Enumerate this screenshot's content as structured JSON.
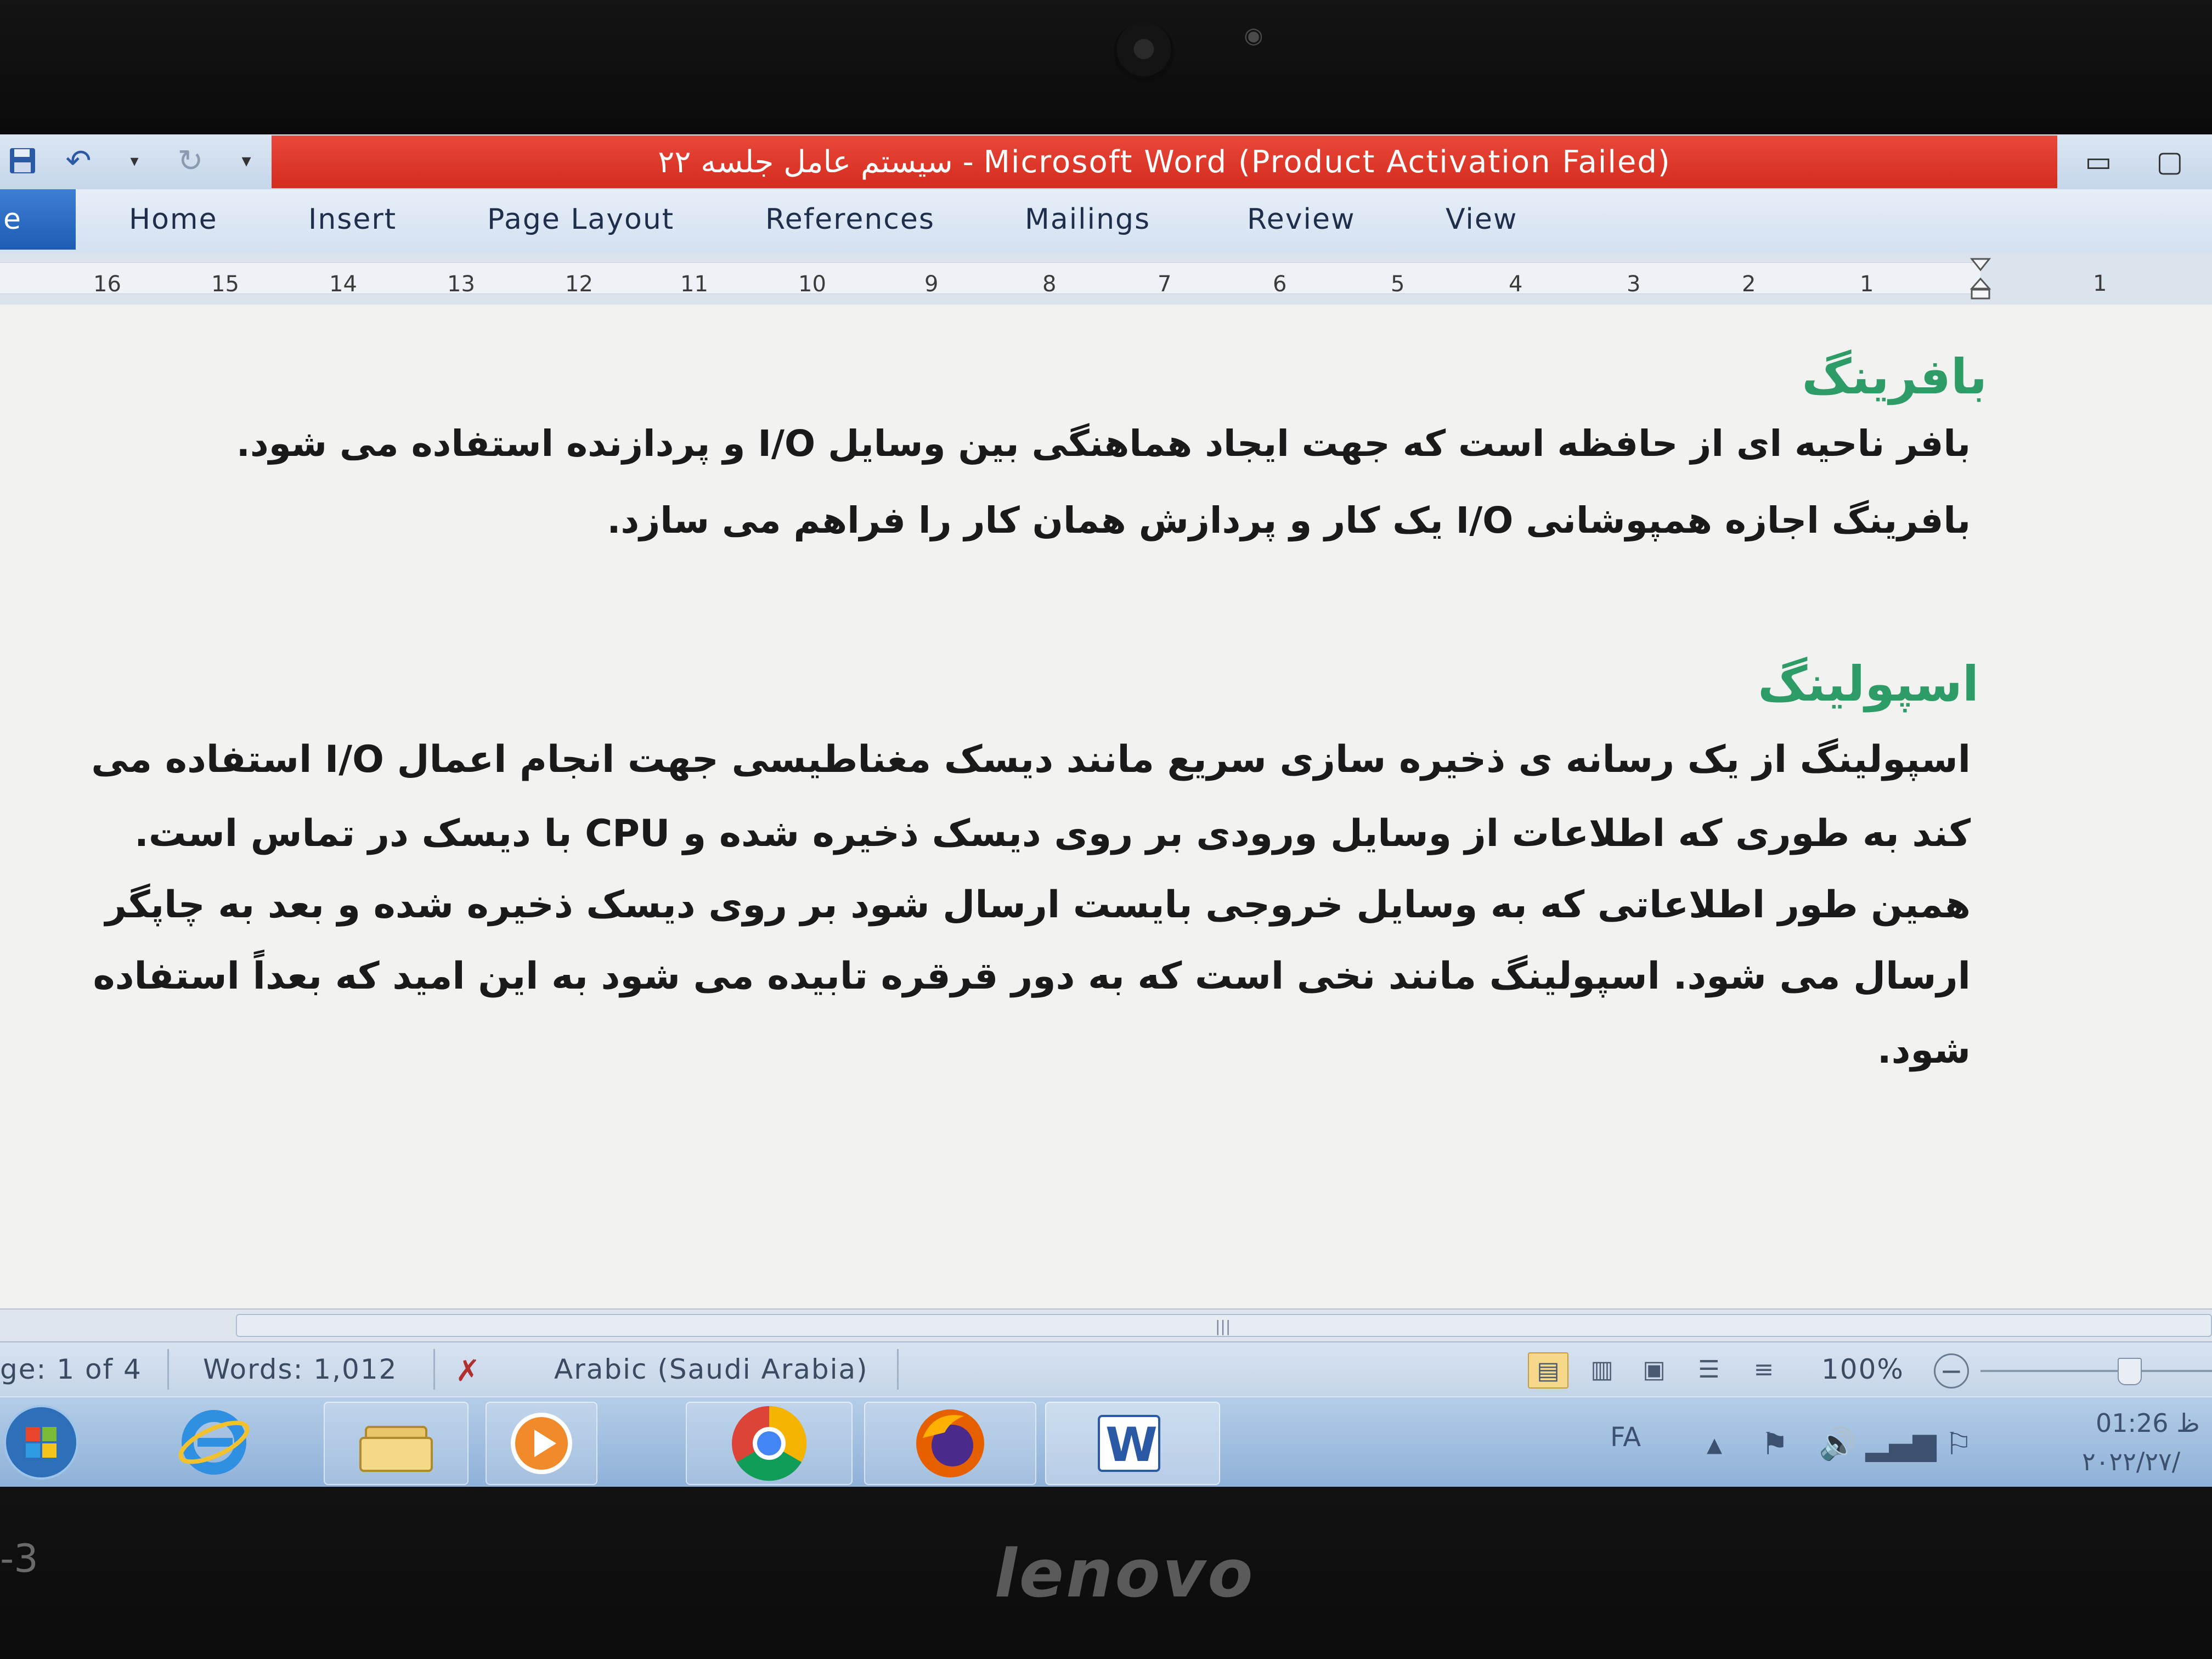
{
  "window": {
    "title": "سیستم عامل جلسه ۲۲  -  Microsoft Word (Product Activation Failed)",
    "title_bar_color": "#d9352a",
    "qat_icons": [
      "save-icon",
      "undo-icon",
      "redo-icon",
      "customize-icon"
    ],
    "controls": [
      "minimize-icon",
      "restore-icon"
    ]
  },
  "ribbon": {
    "file_tab": "e",
    "tabs": [
      "Home",
      "Insert",
      "Page Layout",
      "References",
      "Mailings",
      "Review",
      "View"
    ]
  },
  "ruler": {
    "numbers": [
      "16",
      "15",
      "14",
      "13",
      "12",
      "11",
      "10",
      "9",
      "8",
      "7",
      "6",
      "5",
      "4",
      "3",
      "2",
      "1",
      "1"
    ]
  },
  "document": {
    "heading1": "بافرینگ",
    "para1": [
      "بافر ناحیه ای از حافظه است که جهت ایجاد هماهنگی بین وسایل I/O و پردازنده استفاده می شود.",
      "بافرینگ اجازه همپوشانی I/O یک کار و پردازش همان کار را فراهم می سازد."
    ],
    "heading2": "اسپولینگ",
    "para2": [
      "اسپولینگ از یک رسانه ی ذخیره سازی سریع مانند دیسک مغناطیسی جهت انجام اعمال I/O استفاده می",
      "کند به طوری که اطلاعات از وسایل ورودی بر روی دیسک ذخیره شده و CPU با دیسک در تماس است.",
      "همین طور اطلاعاتی که به وسایل خروجی بایست ارسال شود بر روی دیسک ذخیره شده و بعد به چاپگر",
      "ارسال می شود. اسپولینگ مانند نخی است که به دور قرقره تابیده می شود به این امید که بعداً استفاده",
      "شود."
    ],
    "heading_color": "#2e9c67"
  },
  "statusbar": {
    "page": "ge: 1 of 4",
    "words": "Words: 1,012",
    "language": "Arabic (Saudi Arabia)",
    "zoom": "100%",
    "view_icons": [
      "print-layout-icon",
      "full-screen-reading-icon",
      "web-layout-icon",
      "outline-icon",
      "draft-icon"
    ]
  },
  "taskbar": {
    "items": [
      "start-orb-icon",
      "internet-explorer-icon",
      "file-explorer-icon",
      "media-player-icon",
      "chrome-icon",
      "firefox-icon",
      "word-icon"
    ],
    "language": "FA",
    "time": "01:26 ظ",
    "date": "۲۰۲۲/۲۷/"
  },
  "device": {
    "brand": "lenovo",
    "bezel_mark": "-3"
  }
}
